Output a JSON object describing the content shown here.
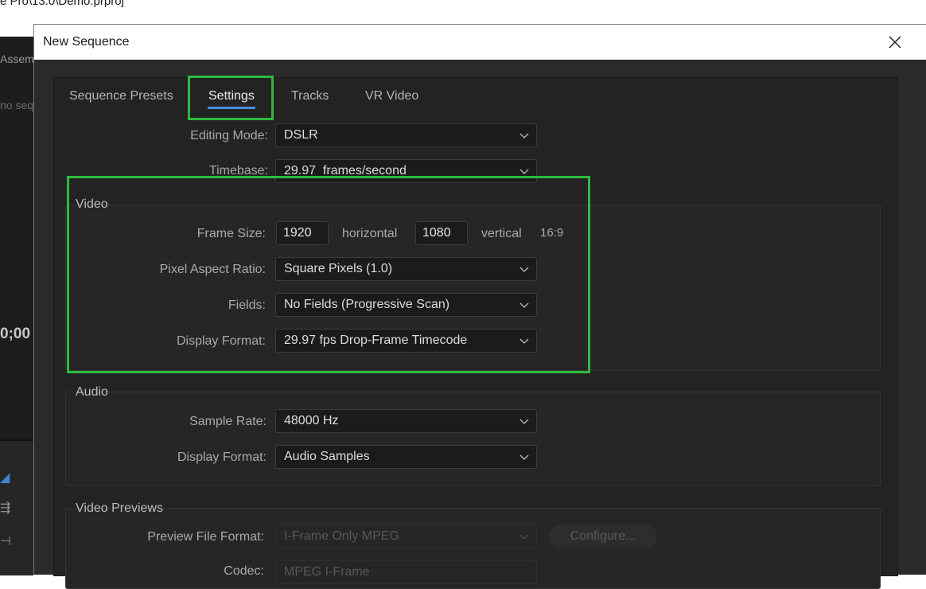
{
  "app": {
    "window_title": "e Pro\\13.0\\Demo.prproj",
    "panel_tab": "Assem",
    "no_sequence": "no seq",
    "timecode": "0;00"
  },
  "dialog": {
    "title": "New Sequence",
    "close_glyph": "✕",
    "tabs": [
      "Sequence Presets",
      "Settings",
      "Tracks",
      "VR Video"
    ],
    "active_tab": "Settings",
    "editing_mode": {
      "label": "Editing Mode:",
      "value": "DSLR"
    },
    "timebase": {
      "label": "Timebase:",
      "value": "29.97  frames/second"
    },
    "video": {
      "title": "Video",
      "frame_size": {
        "label": "Frame Size:",
        "horizontal": "1920",
        "horizontal_label": "horizontal",
        "vertical": "1080",
        "vertical_label": "vertical",
        "aspect": "16:9"
      },
      "pixel_aspect_ratio": {
        "label": "Pixel Aspect Ratio:",
        "value": "Square Pixels (1.0)"
      },
      "fields": {
        "label": "Fields:",
        "value": "No Fields (Progressive Scan)"
      },
      "display_format": {
        "label": "Display Format:",
        "value": "29.97 fps Drop-Frame Timecode"
      }
    },
    "audio": {
      "title": "Audio",
      "sample_rate": {
        "label": "Sample Rate:",
        "value": "48000 Hz"
      },
      "display_format": {
        "label": "Display Format:",
        "value": "Audio Samples"
      }
    },
    "video_previews": {
      "title": "Video Previews",
      "preview_file_format": {
        "label": "Preview File Format:",
        "value": "I-Frame Only MPEG"
      },
      "configure_button": "Configure...",
      "codec": {
        "label": "Codec:",
        "value": "MPEG I-Frame"
      }
    }
  },
  "colors": {
    "highlight": "#2dbb3f",
    "accent": "#4a8edb",
    "dialog_bg": "#232323"
  },
  "icons": {
    "dropdown": "chevron-down-icon",
    "close": "close-icon"
  }
}
